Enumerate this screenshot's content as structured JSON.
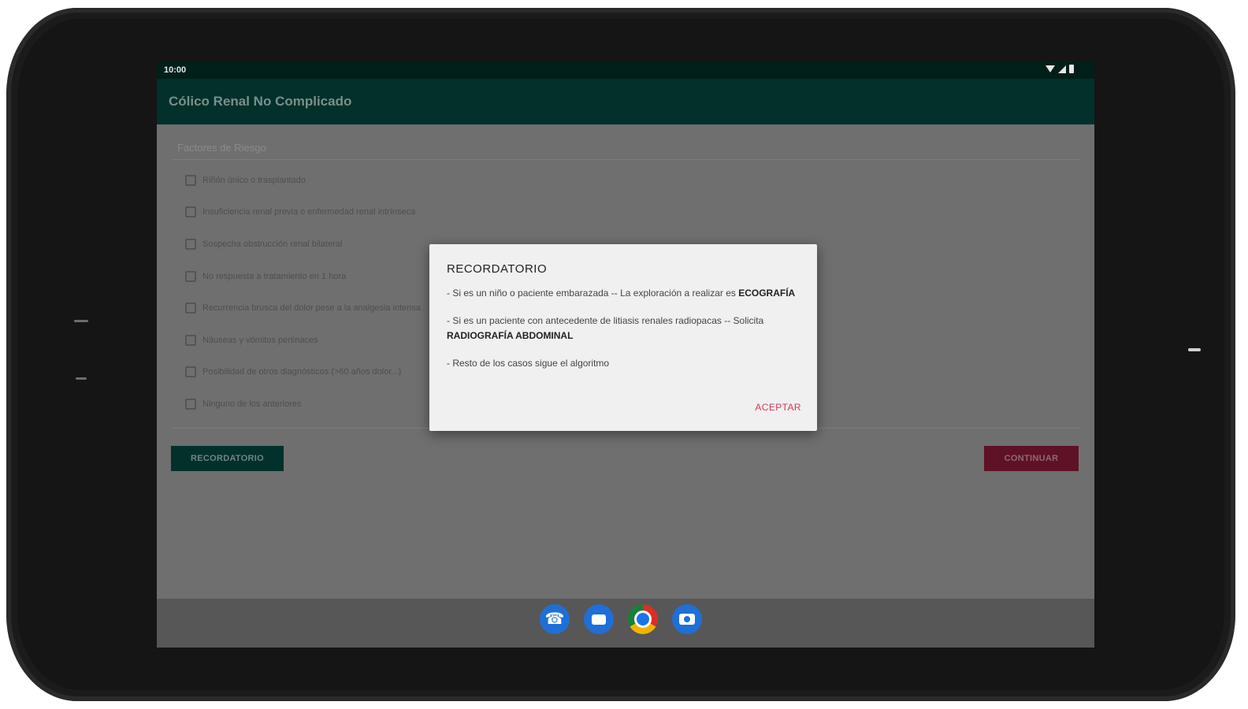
{
  "status_bar": {
    "time": "10:00"
  },
  "app_bar": {
    "title": "Cólico Renal No Complicado"
  },
  "form": {
    "section_label": "Factores de Riesgo",
    "items": [
      {
        "label": "Riñón único o trasplantado",
        "checked": false
      },
      {
        "label": "Insuficiencia renal previa o enfermedad renal intrínseca",
        "checked": false
      },
      {
        "label": "Sospecha obstrucción renal bilateral",
        "checked": false
      },
      {
        "label": "No respuesta a tratamiento en 1 hora",
        "checked": false
      },
      {
        "label": "Recurrencia brusca del dolor pese a la analgesia intensa",
        "checked": false
      },
      {
        "label": "Náuseas y vómitos pertinaces",
        "checked": false
      },
      {
        "label": "Posibilidad de otros diagnósticos (>60 años dolor...)",
        "checked": false
      },
      {
        "label": "Ninguno de los anteriores",
        "checked": false
      }
    ],
    "recordatorio_button": "RECORDATORIO",
    "continuar_button": "CONTINUAR"
  },
  "dialog": {
    "title": "RECORDATORIO",
    "p1_text": "- Si es un niño o paciente embarazada -- La exploración a realizar es",
    "p1_strong": "ECOGRAFÍA",
    "p2_text": "- Si es un paciente con antecedente de litiasis renales radiopacas -- Solicita",
    "p2_strong": "RADIOGRAFÍA ABDOMINAL",
    "p3_text": "- Resto de los casos sigue el algoritmo",
    "accept": "ACEPTAR"
  },
  "dock": {
    "apps": [
      "phone-icon",
      "messages-icon",
      "chrome-icon",
      "camera-icon"
    ]
  },
  "colors": {
    "app_bar": "#02302a",
    "status_bar": "#001f19",
    "continue_button": "#5f1125",
    "accept_text": "#d6375b"
  }
}
